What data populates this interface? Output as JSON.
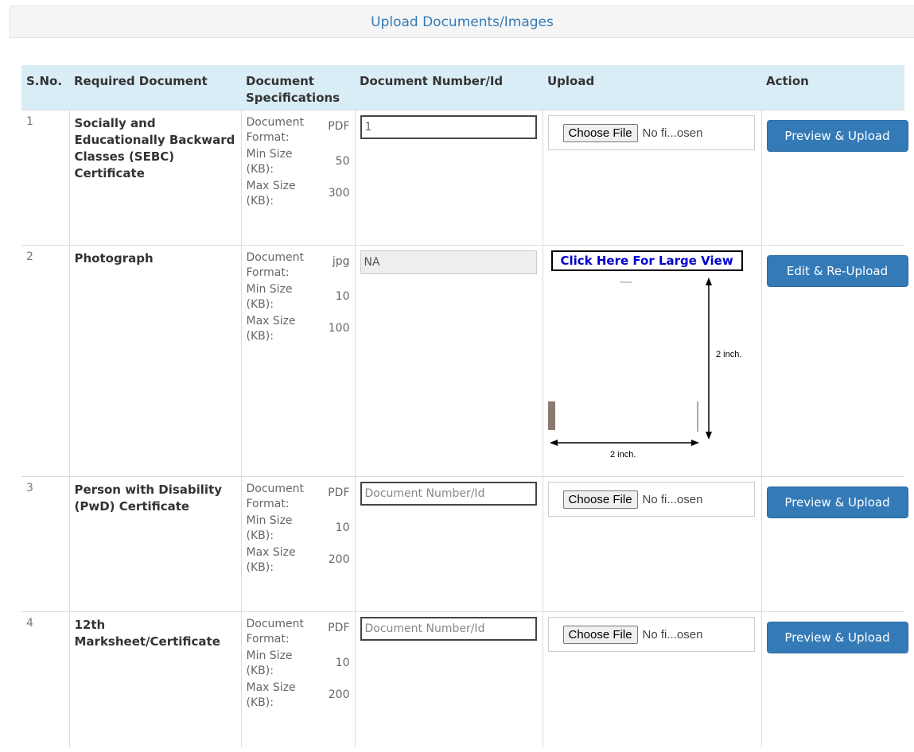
{
  "header": {
    "title": "Upload Documents/Images"
  },
  "table": {
    "columns": {
      "sno": "S.No.",
      "required_document": "Required Document",
      "specifications": "Document Specifications",
      "document_number": "Document Number/Id",
      "upload": "Upload",
      "action": "Action"
    },
    "spec_labels": {
      "format": "Document Format:",
      "min": "Min Size (KB):",
      "max": "Max Size (KB):"
    },
    "upload_labels": {
      "choose_file": "Choose File",
      "no_file": "No fi...osen"
    },
    "rows": [
      {
        "sno": "1",
        "document": "Socially and Educationally Backward Classes (SEBC) Certificate",
        "format": "PDF",
        "min": "50",
        "max": "300",
        "number_value": "1",
        "number_placeholder": "Document Number/Id",
        "action": "Preview & Upload"
      },
      {
        "sno": "2",
        "document": "Photograph",
        "format": "jpg",
        "min": "10",
        "max": "100",
        "number_value": "NA",
        "large_view": "Click Here For Large View",
        "dim_right": "2 inch.",
        "dim_bottom": "2 inch.",
        "action": "Edit & Re-Upload"
      },
      {
        "sno": "3",
        "document": "Person with Disability (PwD) Certificate",
        "format": "PDF",
        "min": "10",
        "max": "200",
        "number_value": "",
        "number_placeholder": "Document Number/Id",
        "action": "Preview & Upload"
      },
      {
        "sno": "4",
        "document": "12th Marksheet/Certificate",
        "format": "PDF",
        "min": "10",
        "max": "200",
        "number_value": "",
        "number_placeholder": "Document Number/Id",
        "action": "Preview & Upload"
      }
    ]
  }
}
